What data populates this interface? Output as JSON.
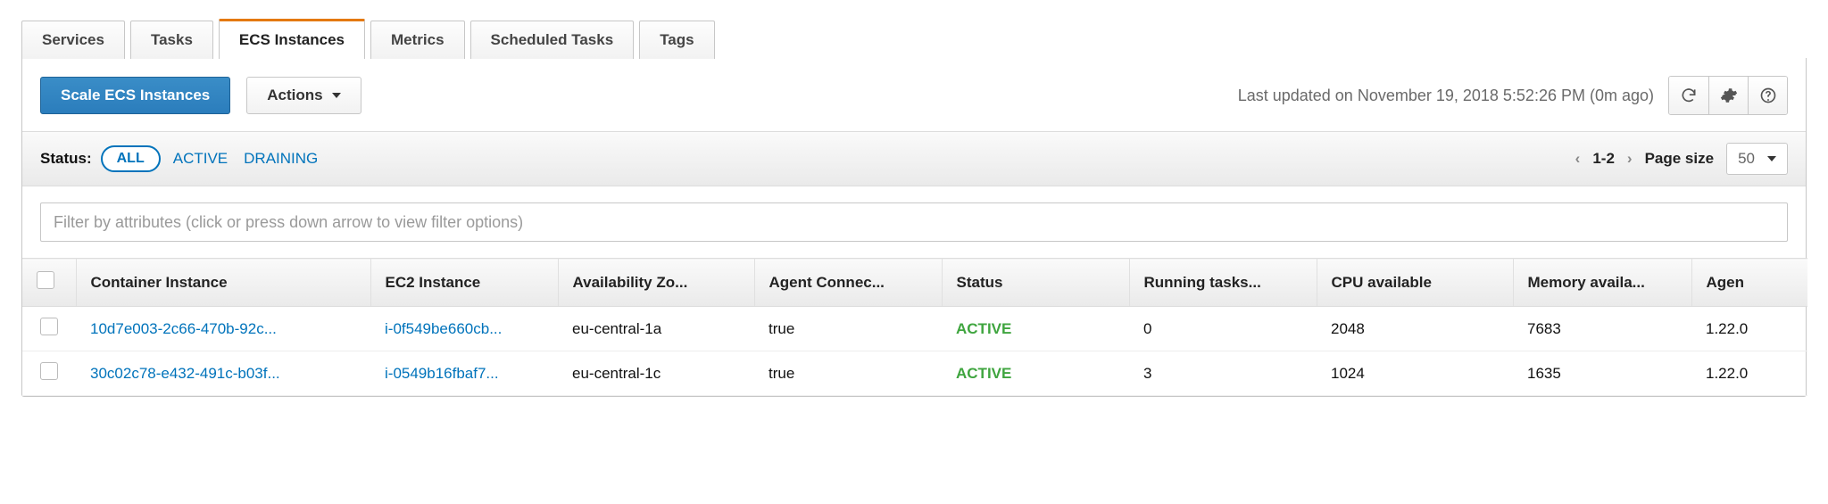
{
  "tabs": {
    "services": "Services",
    "tasks": "Tasks",
    "ecs_instances": "ECS Instances",
    "metrics": "Metrics",
    "scheduled_tasks": "Scheduled Tasks",
    "tags": "Tags",
    "active": "ecs_instances"
  },
  "toolbar": {
    "scale_btn": "Scale ECS Instances",
    "actions_btn": "Actions",
    "last_updated": "Last updated on November 19, 2018 5:52:26 PM (0m ago)"
  },
  "status_filter": {
    "label": "Status:",
    "all": "ALL",
    "active": "ACTIVE",
    "draining": "DRAINING"
  },
  "pager": {
    "range": "1-2",
    "page_size_label": "Page size",
    "page_size_value": "50"
  },
  "filter": {
    "placeholder": "Filter by attributes (click or press down arrow to view filter options)"
  },
  "table": {
    "columns": {
      "container_instance": "Container Instance",
      "ec2_instance": "EC2 Instance",
      "availability_zone": "Availability Zo...",
      "agent_connected": "Agent Connec...",
      "status": "Status",
      "running_tasks": "Running tasks...",
      "cpu_available": "CPU available",
      "memory_available": "Memory availa...",
      "agent_version": "Agen"
    },
    "rows": [
      {
        "container_instance": "10d7e003-2c66-470b-92c...",
        "ec2_instance": "i-0f549be660cb...",
        "availability_zone": "eu-central-1a",
        "agent_connected": "true",
        "status": "ACTIVE",
        "running_tasks": "0",
        "cpu_available": "2048",
        "memory_available": "7683",
        "agent_version": "1.22.0"
      },
      {
        "container_instance": "30c02c78-e432-491c-b03f...",
        "ec2_instance": "i-0549b16fbaf7...",
        "availability_zone": "eu-central-1c",
        "agent_connected": "true",
        "status": "ACTIVE",
        "running_tasks": "3",
        "cpu_available": "1024",
        "memory_available": "1635",
        "agent_version": "1.22.0"
      }
    ]
  }
}
